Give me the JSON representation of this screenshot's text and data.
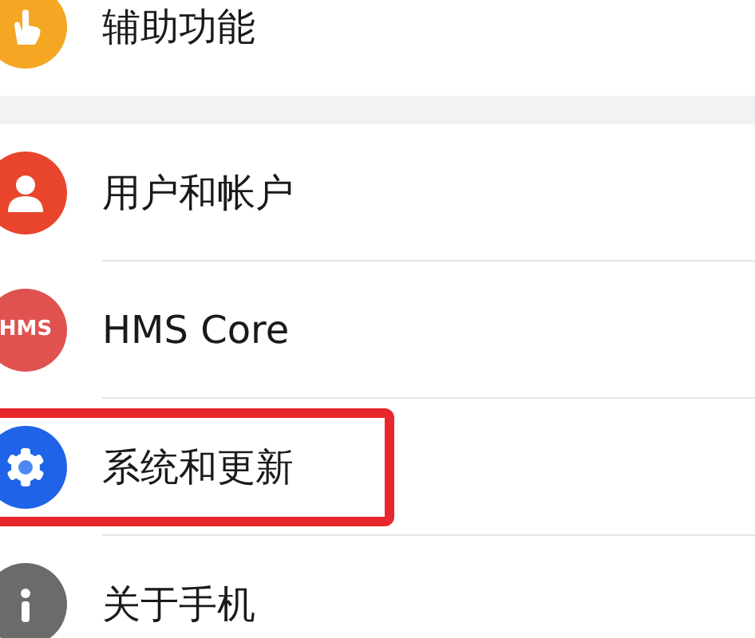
{
  "groups": [
    {
      "items": [
        {
          "label": "辅助功能",
          "kind": "accessibility",
          "highlighted": false
        }
      ]
    },
    {
      "items": [
        {
          "label": "用户和帐户",
          "kind": "user",
          "highlighted": false
        },
        {
          "label": "HMS Core",
          "kind": "hms",
          "icon_text": "HMS",
          "highlighted": false
        },
        {
          "label": "系统和更新",
          "kind": "gear",
          "highlighted": true
        },
        {
          "label": "关于手机",
          "kind": "info",
          "highlighted": false
        }
      ]
    }
  ]
}
